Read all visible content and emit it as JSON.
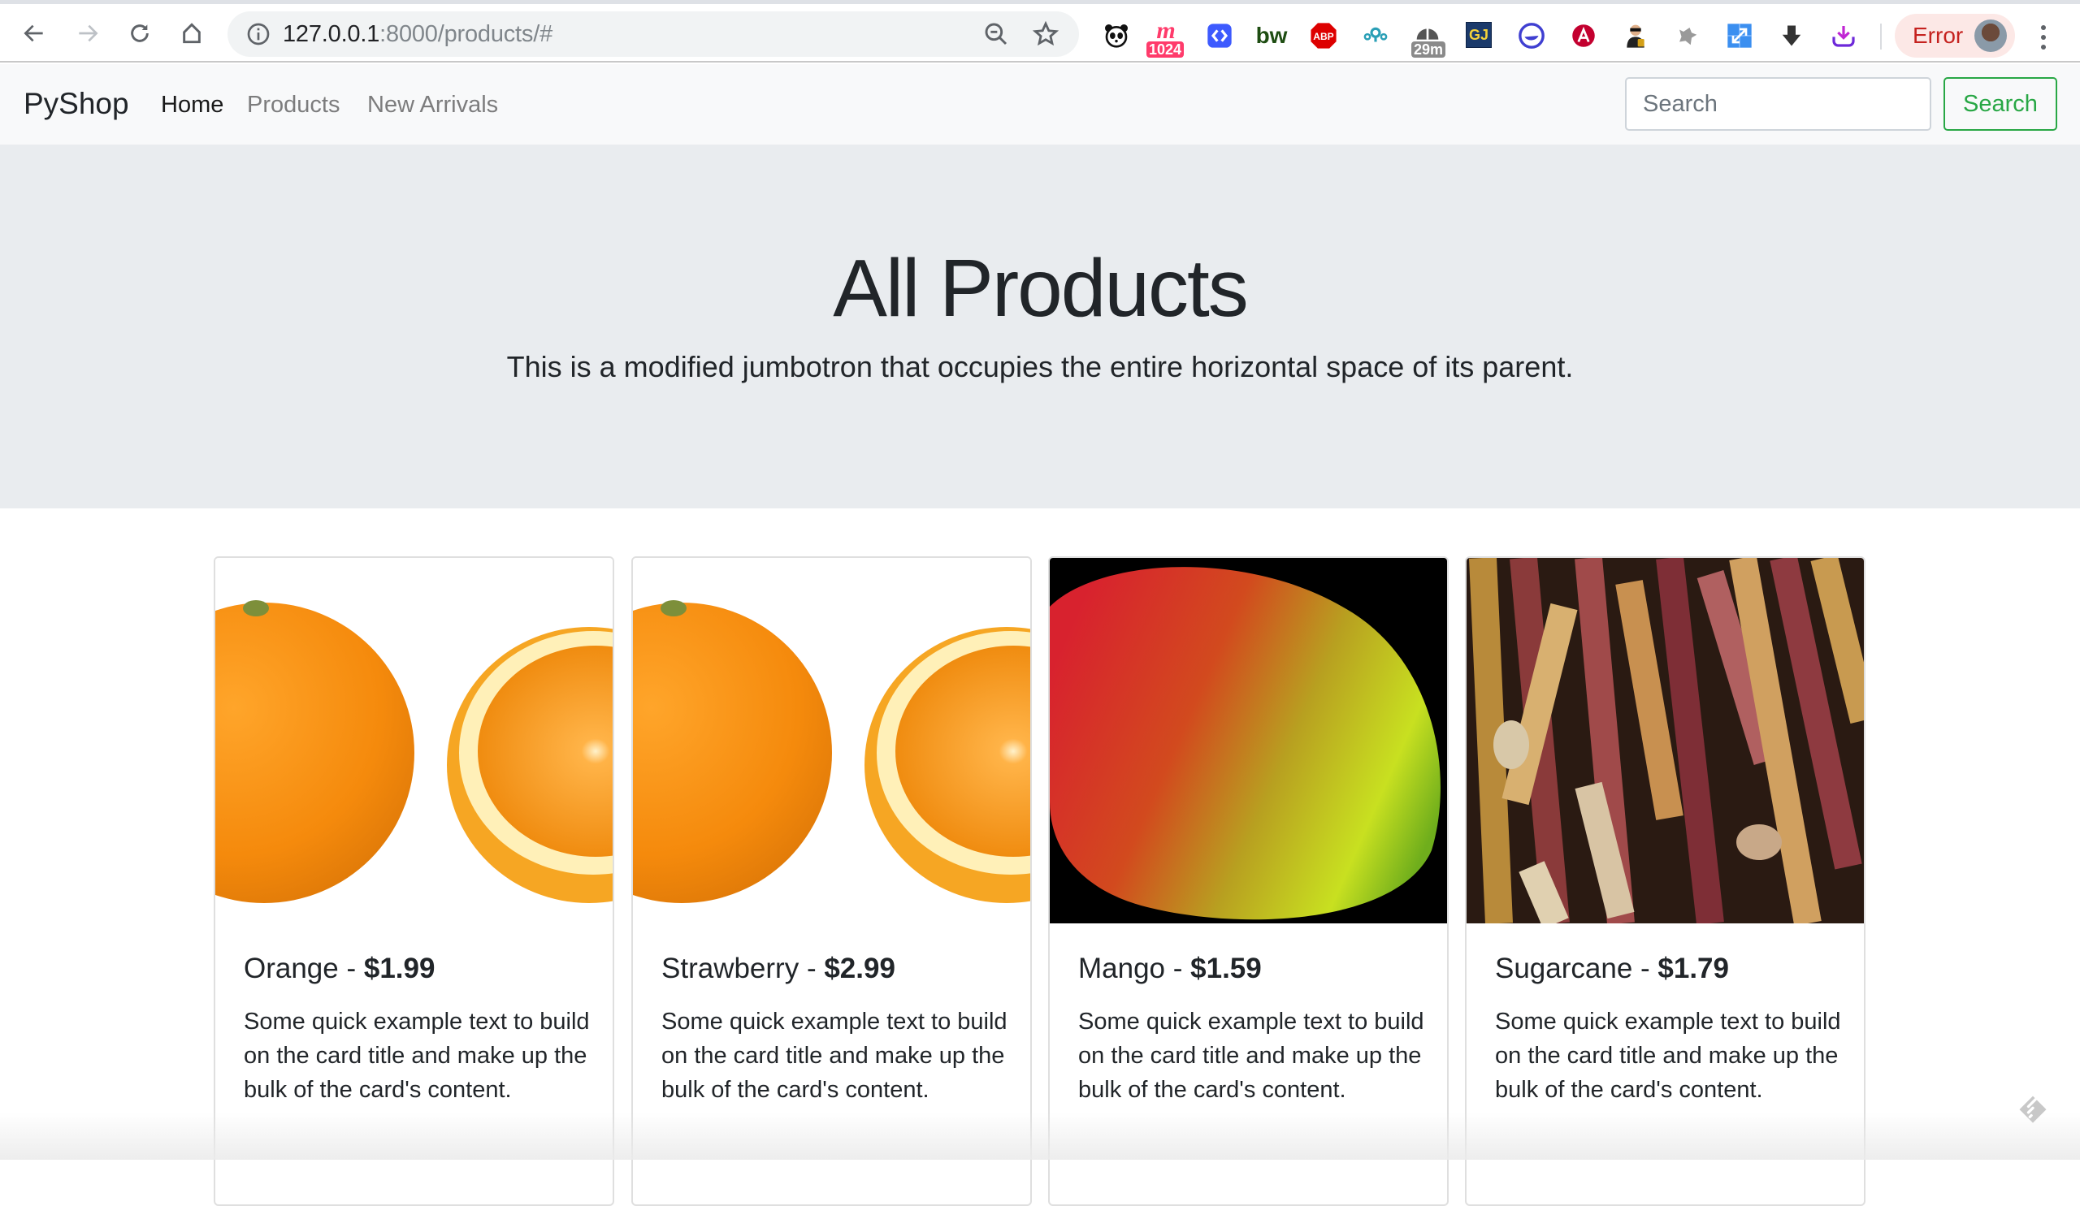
{
  "browser": {
    "url_host": "127.0.0.1",
    "url_rest": ":8000/products/#",
    "profile_label": "Error",
    "extensions": [
      {
        "name": "panda-extension-icon",
        "label": ""
      },
      {
        "name": "m-extension-icon",
        "label": "m",
        "badge": "1024",
        "badge_color": "#ff3b6b"
      },
      {
        "name": "dev-extension-icon",
        "label": ""
      },
      {
        "name": "bw-extension-icon",
        "label": "bw"
      },
      {
        "name": "adblock-plus-icon",
        "label": "ABP"
      },
      {
        "name": "location-extension-icon",
        "label": ""
      },
      {
        "name": "timer-extension-icon",
        "label": "",
        "badge": "29m",
        "badge_color": "#8a8a8a"
      },
      {
        "name": "gj-extension-icon",
        "label": "GJ"
      },
      {
        "name": "circle-extension-icon",
        "label": ""
      },
      {
        "name": "angular-extension-icon",
        "label": "A"
      },
      {
        "name": "agent-extension-icon",
        "label": ""
      },
      {
        "name": "wolf-extension-icon",
        "label": ""
      },
      {
        "name": "resize-extension-icon",
        "label": ""
      },
      {
        "name": "download-arrow-icon",
        "label": ""
      },
      {
        "name": "download-tray-icon",
        "label": ""
      }
    ]
  },
  "navbar": {
    "brand": "PyShop",
    "links": [
      {
        "label": "Home",
        "active": true
      },
      {
        "label": "Products",
        "active": false
      },
      {
        "label": "New Arrivals",
        "active": false
      }
    ],
    "search_placeholder": "Search",
    "search_button": "Search",
    "accent_color": "#28a745"
  },
  "jumbotron": {
    "title": "All Products",
    "lead": "This is a modified jumbotron that occupies the entire horizontal space of its parent."
  },
  "products": [
    {
      "name": "Orange",
      "separator": " - ",
      "price": "$1.99",
      "text": "Some quick example text to build on the card title and make up the bulk of the card's content.",
      "image": "orange"
    },
    {
      "name": "Strawberry",
      "separator": " - ",
      "price": "$2.99",
      "text": "Some quick example text to build on the card title and make up the bulk of the card's content.",
      "image": "orange"
    },
    {
      "name": "Mango",
      "separator": " - ",
      "price": "$1.59",
      "text": "Some quick example text to build on the card title and make up the bulk of the card's content.",
      "image": "mango"
    },
    {
      "name": "Sugarcane",
      "separator": " - ",
      "price": "$1.79",
      "text": "Some quick example text to build on the card title and make up the bulk of the card's content.",
      "image": "sugarcane"
    }
  ]
}
